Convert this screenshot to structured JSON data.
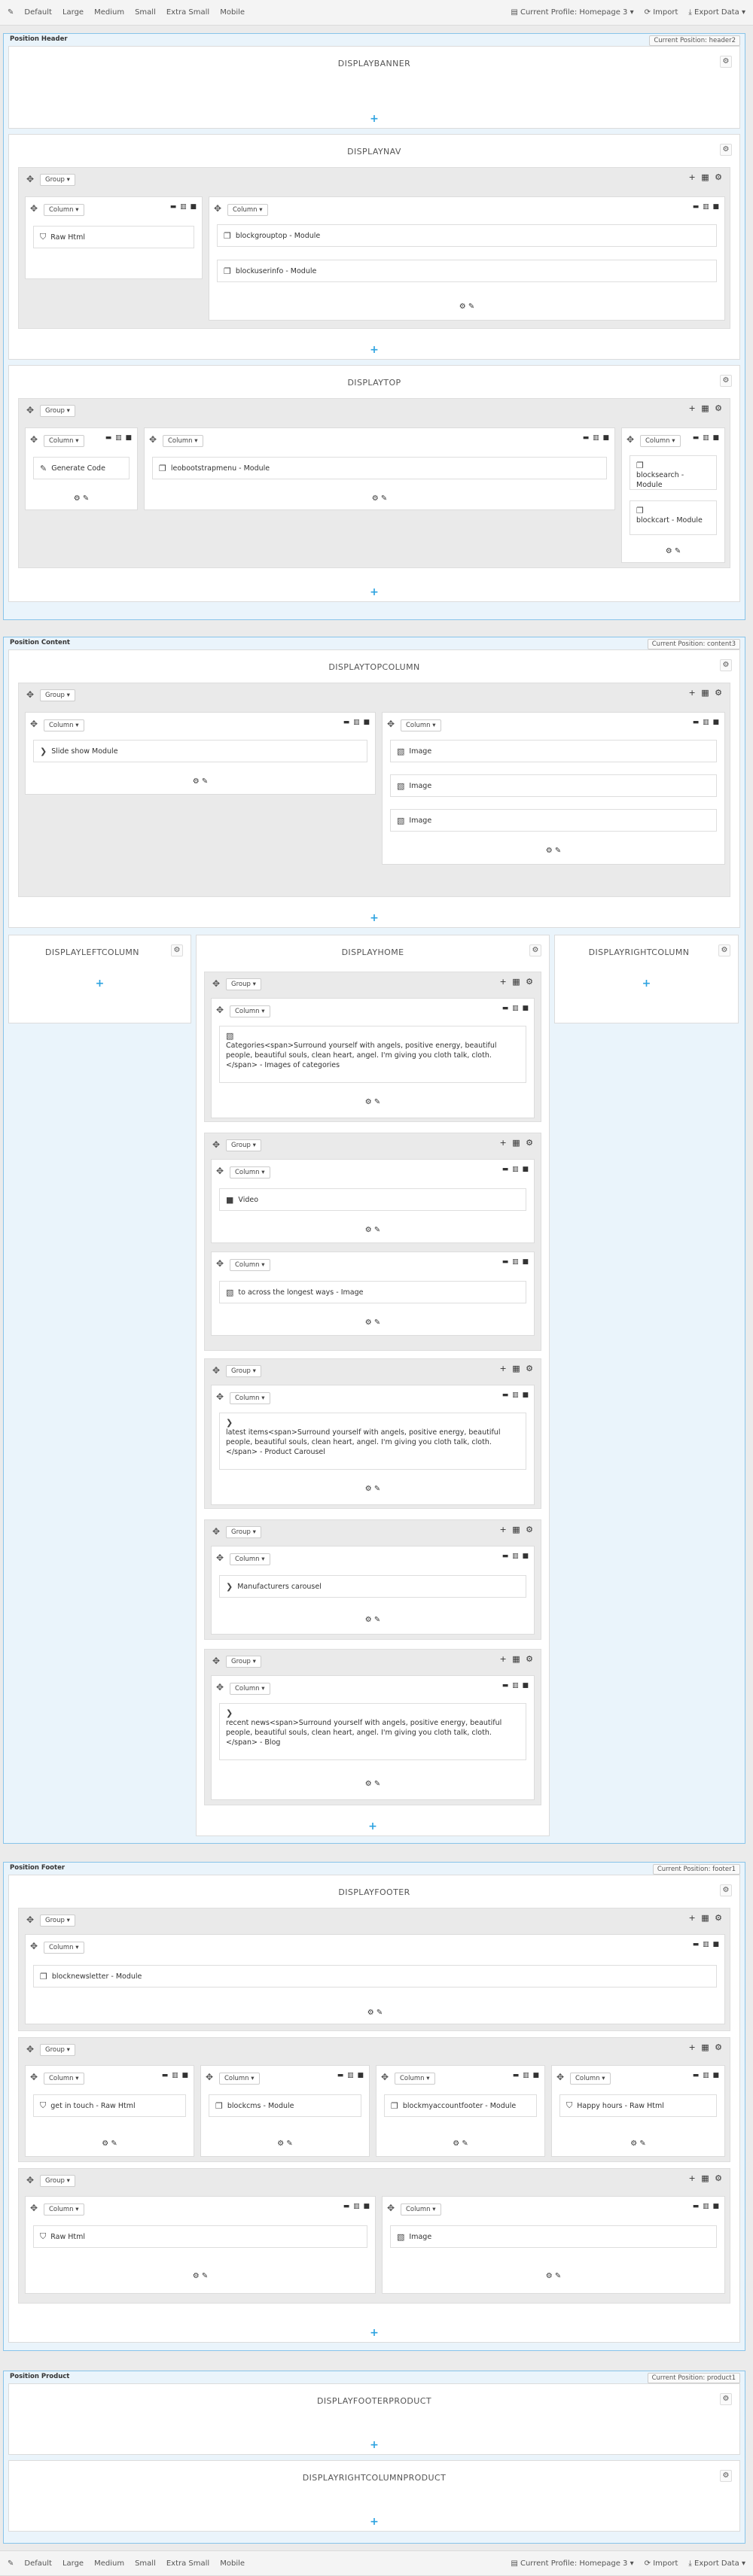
{
  "toolbar": {
    "items": [
      "Default",
      "Large",
      "Medium",
      "Small",
      "Extra Small",
      "Mobile"
    ],
    "profile": "Current Profile: Homepage 3",
    "import": "Import",
    "export": "Export Data"
  },
  "header": {
    "title": "Position Header",
    "badge": "Current Position: header2",
    "displaybanner": "DISPLAYBANNER",
    "displaynav": "DISPLAYNAV",
    "displaytop": "DISPLAYTOP"
  },
  "content": {
    "title": "Position Content",
    "badge": "Current Position: content3",
    "displaytopcolumn": "DISPLAYTOPCOLUMN",
    "displayleftcolumn": "DISPLAYLEFTCOLUMN",
    "displayhome": "DISPLAYHOME",
    "displayrightcolumn": "DISPLAYRIGHTCOLUMN"
  },
  "footer": {
    "title": "Position Footer",
    "badge": "Current Position: footer1",
    "displayfooter": "DISPLAYFOOTER"
  },
  "product": {
    "title": "Position Product",
    "badge": "Current Position: product1",
    "displayfooterproduct": "DISPLAYFOOTERPRODUCT",
    "displayrightcolumnproduct": "DISPLAYRIGHTCOLUMNPRODUCT"
  },
  "labels": {
    "group": "Group",
    "column": "Column"
  },
  "widgets": {
    "nav_raw": "Raw Html",
    "nav_groupstop": "blockgrouptop - Module",
    "nav_userinfo": "blockuserinfo - Module",
    "top_code": "Generate Code",
    "top_menu": "leobootstrapmenu - Module",
    "top_search": "blocksearch - Module",
    "top_cart": "blockcart - Module",
    "tc_slide": "Slide show Module",
    "tc_img1": "Image",
    "tc_img2": "Image",
    "tc_img3": "Image",
    "home_categories": "Categories<span>Surround yourself with angels, positive energy, beautiful people, beautiful souls, clean heart, angel. I'm giving you cloth talk, cloth.</span> - Images of categories",
    "home_video": "Video",
    "home_image": "to across the longest ways - Image",
    "home_latest": "latest items<span>Surround yourself with angels, positive energy, beautiful people, beautiful souls, clean heart, angel. I'm giving you cloth talk, cloth.</span> - Product Carousel",
    "home_manufacturers": "Manufacturers carousel",
    "home_news": "recent news<span>Surround yourself with angels, positive energy, beautiful people, beautiful souls, clean heart, angel. I'm giving you cloth talk, cloth.</span> - Blog",
    "f_newsletter": "blocknewsletter - Module",
    "f_getintouch": "get in touch - Raw Html",
    "f_cms": "blockcms - Module",
    "f_myaccount": "blockmyaccountfooter - Module",
    "f_happy": "Happy hours - Raw Html",
    "f_raw": "Raw Html",
    "f_image": "Image"
  }
}
